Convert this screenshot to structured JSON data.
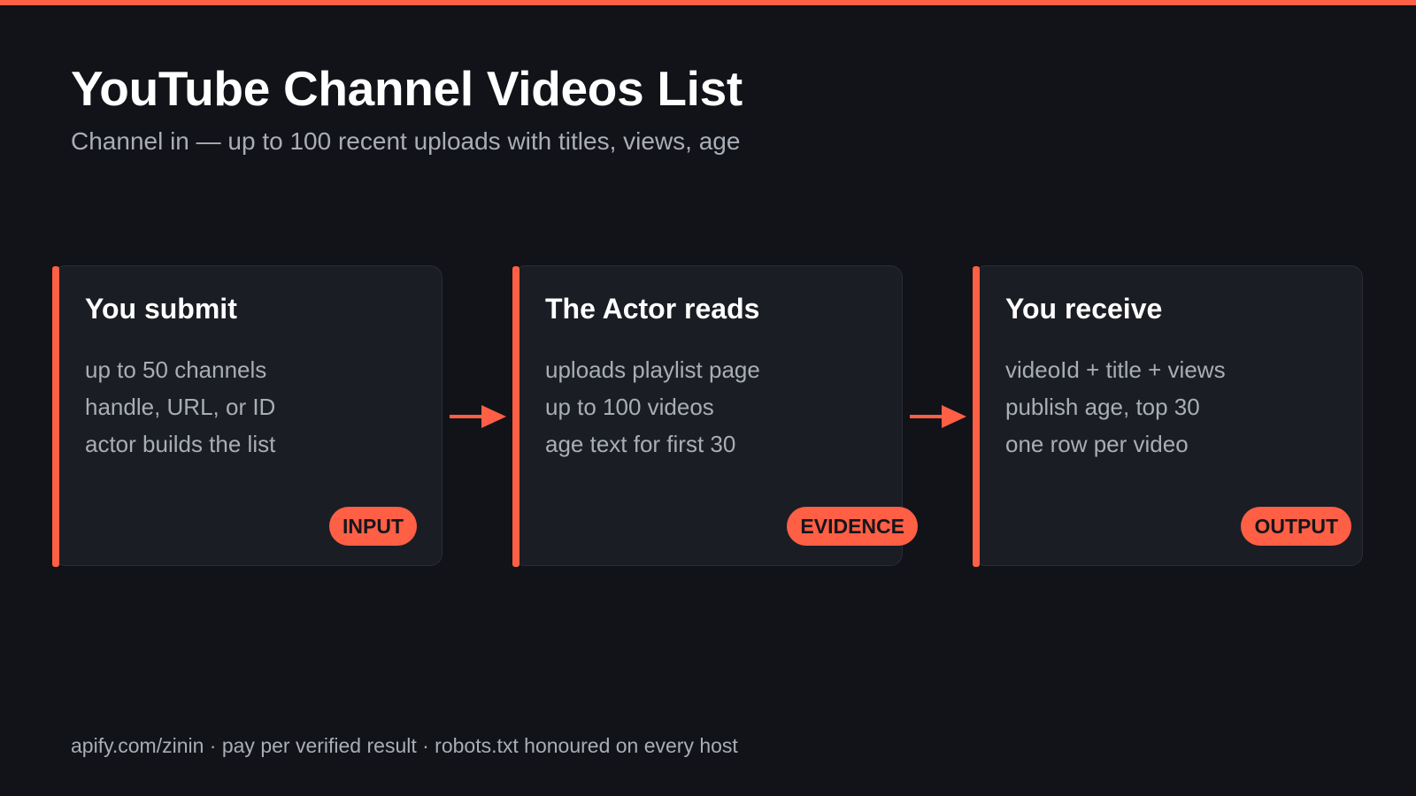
{
  "header": {
    "title": "YouTube Channel Videos List",
    "subtitle": "Channel in — up to 100 recent uploads with titles, views, age"
  },
  "cards": [
    {
      "title": "You submit",
      "lines": [
        "up to 50 channels",
        "handle, URL, or ID",
        "actor builds the list"
      ],
      "badge": "INPUT"
    },
    {
      "title": "The Actor reads",
      "lines": [
        "uploads playlist page",
        "up to 100 videos",
        "age text for first 30"
      ],
      "badge": "EVIDENCE"
    },
    {
      "title": "You receive",
      "lines": [
        "videoId + title + views",
        "publish age, top 30",
        "one row per video"
      ],
      "badge": "OUTPUT"
    }
  ],
  "footer": {
    "text": "apify.com/zinin · pay per verified result · robots.txt honoured on every host"
  },
  "colors": {
    "accent": "#ff5f45",
    "background": "#111318",
    "card": "#1b1d24",
    "text_primary": "#ffffff",
    "text_secondary": "#a9adb6"
  },
  "icons": [
    "arrow-right-icon"
  ]
}
